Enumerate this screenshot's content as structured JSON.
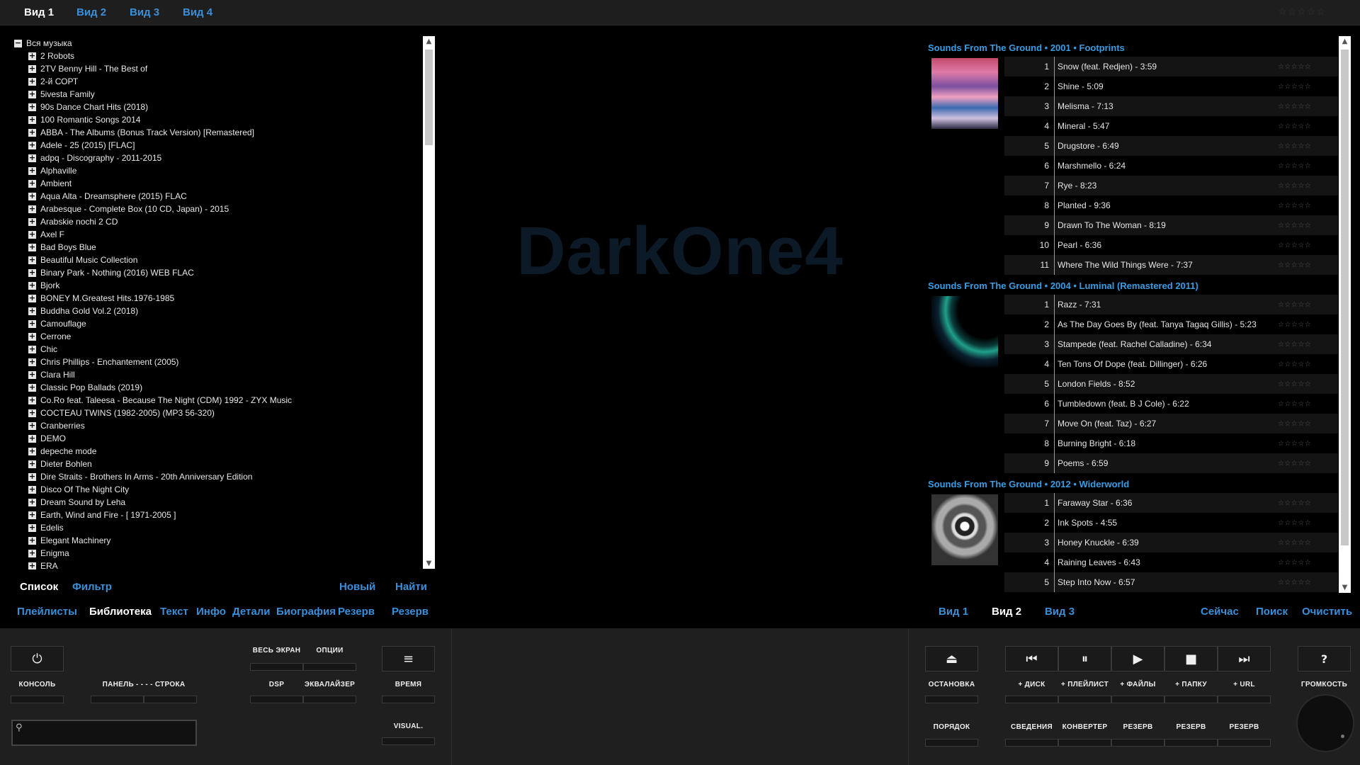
{
  "top_tabs": [
    "Вид 1",
    "Вид 2",
    "Вид 3",
    "Вид 4"
  ],
  "top_rating": "☆☆☆☆☆",
  "library": {
    "root": "Вся музыка",
    "items": [
      "2 Robots",
      "2TV Benny Hill - The Best of",
      "2-й СОРТ",
      "5ivesta Family",
      "90s Dance Chart Hits (2018)",
      "100 Romantic Songs 2014",
      "ABBA - The Albums (Bonus Track Version) [Remastered]",
      "Adele - 25 (2015) [FLAC]",
      "adpq - Discography - 2011-2015",
      "Alphaville",
      "Ambient",
      "Aqua Alta - Dreamsphere (2015) FLAC",
      "Arabesque - Complete Box (10 CD, Japan) - 2015",
      "Arabskie nochi  2 CD",
      "Axel F",
      "Bad Boys Blue",
      "Beautiful Music Collection",
      "Binary Park - Nothing (2016) WEB FLAC",
      "Bjork",
      "BONEY M.Greatest Hits.1976-1985",
      "Buddha Gold Vol.2 (2018)",
      "Camouflage",
      "Cerrone",
      "Chic",
      "Chris Phillips - Enchantement  (2005)",
      "Clara Hill",
      "Classic Pop Ballads (2019)",
      "Co.Ro feat. Taleesa - Because The Night (CDM) 1992 - ZYX Music",
      "COCTEAU TWINS (1982-2005) (MP3 56-320)",
      "Cranberries",
      "DEMO",
      "depeche mode",
      "Dieter Bohlen",
      "Dire Straits - Brothers In Arms - 20th Anniversary Edition",
      "Disco Of The Night City",
      "Dream Sound by Leha",
      "Earth, Wind and Fire - [ 1971-2005 ]",
      "Edelis",
      "Elegant Machinery",
      "Enigma",
      "ERA"
    ]
  },
  "left_tabs_row1": {
    "list": "Список",
    "filter": "Фильтр",
    "new": "Новый",
    "find": "Найти"
  },
  "left_tabs_row2": [
    "Плейлисты",
    "Библиотека",
    "Текст",
    "Инфо",
    "Детали",
    "Биография",
    "Резерв",
    "Резерв"
  ],
  "watermark": "DarkOne4",
  "playlist": {
    "albums": [
      {
        "header": "Sounds From The Ground • 2001 • Footprints",
        "tracks": [
          [
            "1",
            "Snow (feat. Redjen) - 3:59"
          ],
          [
            "2",
            "Shine - 5:09"
          ],
          [
            "3",
            "Melisma - 7:13"
          ],
          [
            "4",
            "Mineral - 5:47"
          ],
          [
            "5",
            "Drugstore - 6:49"
          ],
          [
            "6",
            "Marshmello - 6:24"
          ],
          [
            "7",
            "Rye - 8:23"
          ],
          [
            "8",
            "Planted - 9:36"
          ],
          [
            "9",
            "Drawn To The Woman - 8:19"
          ],
          [
            "10",
            "Pearl - 6:36"
          ],
          [
            "11",
            "Where The Wild Things Were - 7:37"
          ]
        ]
      },
      {
        "header": "Sounds From The Ground • 2004 • Luminal (Remastered 2011)",
        "tracks": [
          [
            "1",
            "Razz - 7:31"
          ],
          [
            "2",
            "As The Day Goes By (feat. Tanya Tagaq Gillis) - 5:23"
          ],
          [
            "3",
            "Stampede (feat. Rachel Calladine) - 6:34"
          ],
          [
            "4",
            "Ten Tons Of Dope (feat. Dillinger) - 6:26"
          ],
          [
            "5",
            "London Fields - 8:52"
          ],
          [
            "6",
            "Tumbledown (feat. B J Cole) - 6:22"
          ],
          [
            "7",
            "Move On (feat. Taz) - 6:27"
          ],
          [
            "8",
            "Burning Bright - 6:18"
          ],
          [
            "9",
            "Poems - 6:59"
          ]
        ]
      },
      {
        "header": "Sounds From The Ground • 2012 • Widerworld",
        "tracks": [
          [
            "1",
            "Faraway Star - 6:36"
          ],
          [
            "2",
            "Ink Spots - 4:55"
          ],
          [
            "3",
            "Honey Knuckle - 6:39"
          ],
          [
            "4",
            "Raining Leaves - 6:43"
          ],
          [
            "5",
            "Step Into Now - 6:57"
          ]
        ]
      }
    ],
    "rating_glyph": "☆☆☆☆☆"
  },
  "right_tabs": {
    "view1": "Вид 1",
    "view2": "Вид 2",
    "view3": "Вид 3",
    "now": "Сейчас",
    "search": "Поиск",
    "clear": "Очистить"
  },
  "controls": {
    "console": "КОНСОЛЬ",
    "panel_row": "ПАНЕЛЬ - - - - СТРОКА",
    "fullscreen": "ВЕСЬ ЭКРАН",
    "options": "ОПЦИИ",
    "dsp": "DSP",
    "equalizer": "ЭКВАЛАЙЗЕР",
    "time": "ВРЕМЯ",
    "visual": "VISUAL.",
    "stop_after": "ОСТАНОВКА",
    "order": "ПОРЯДОК",
    "add_disc": "+ ДИСК",
    "add_playlist": "+ ПЛЕЙЛИСТ",
    "add_files": "+ ФАЙЛЫ",
    "add_folder": "+ ПАПКУ",
    "add_url": "+ URL",
    "info": "СВЕДЕНИЯ",
    "converter": "КОНВЕРТЕР",
    "reserve": "РЕЗЕРВ",
    "volume": "ГРОМКОСТЬ"
  },
  "icons": {
    "power": "⏻",
    "menu": "≡",
    "eject": "⏏",
    "prev": "⏮",
    "pause": "⏸",
    "play": "▶",
    "stop": "■",
    "next": "⏭",
    "help": "?"
  },
  "colors": {
    "accent": "#3a8fd8",
    "header_blue": "#3a9ce2",
    "panel_bg": "#1f1f1f"
  }
}
